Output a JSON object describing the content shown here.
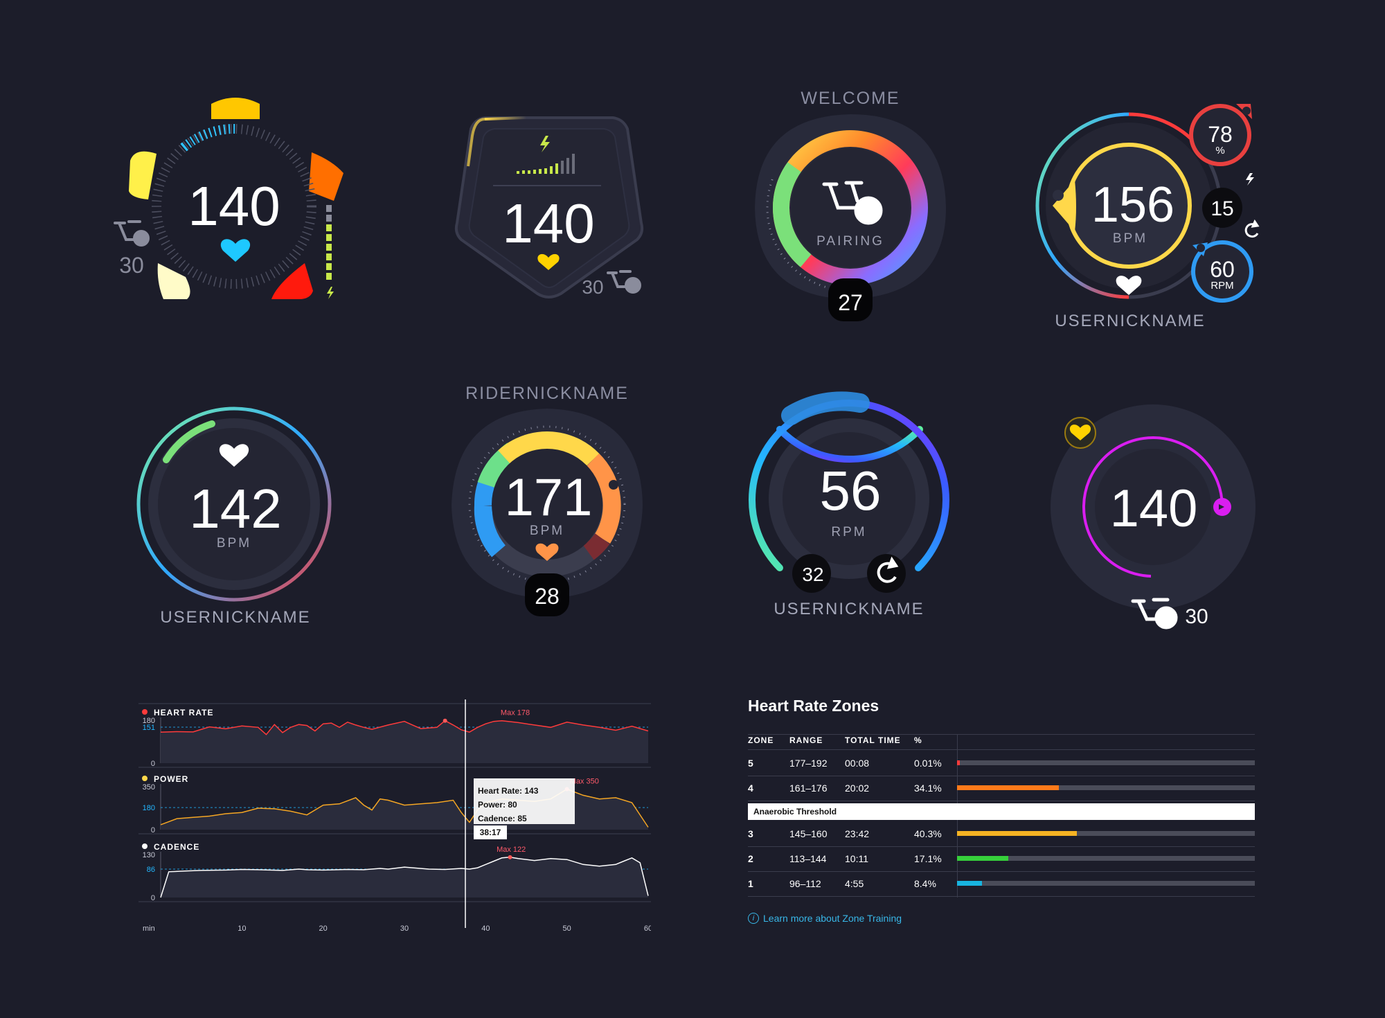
{
  "widgets": {
    "w1": {
      "value": "140",
      "bike_count": "30"
    },
    "w2": {
      "value": "140",
      "bike_count": "30"
    },
    "w3": {
      "title": "WELCOME",
      "status": "PAIRING",
      "badge": "27"
    },
    "w4": {
      "value": "156",
      "unit": "BPM",
      "nickname": "USERNICKNAME",
      "percent_value": "78",
      "percent_unit": "%",
      "power_value": "15",
      "cadence_value": "60",
      "cadence_unit": "RPM"
    },
    "w5": {
      "value": "142",
      "unit": "BPM",
      "nickname": "USERNICKNAME"
    },
    "w6": {
      "title": "RIDERNICKNAME",
      "value": "171",
      "unit": "BPM",
      "badge": "28"
    },
    "w7": {
      "value": "56",
      "unit": "RPM",
      "sub_value": "32",
      "nickname": "USERNICKNAME"
    },
    "w8": {
      "value": "140",
      "bike_count": "30"
    }
  },
  "chart_data": {
    "type": "line",
    "x_axis": {
      "label": "min",
      "ticks": [
        "10",
        "20",
        "30",
        "40",
        "50",
        "60"
      ],
      "range": [
        0,
        60
      ]
    },
    "cursor": {
      "x": 37.5,
      "time_label": "38:17"
    },
    "tooltip": {
      "heart_rate": "Heart Rate: 143",
      "power": "Power: 80",
      "cadence": "Cadence: 85"
    },
    "panels": [
      {
        "name": "HEART RATE",
        "color": "#ff3b3b",
        "ylim": [
          0,
          180
        ],
        "ticks": [
          "180",
          "0"
        ],
        "avg": 151,
        "avg_label": "151",
        "max_label": "Max 178",
        "max_x": 41.5,
        "x": [
          0,
          2,
          4,
          6,
          8,
          10,
          12,
          13,
          14,
          15,
          16,
          17,
          18,
          19,
          20,
          21,
          22,
          23,
          24,
          25,
          26,
          28,
          30,
          31,
          32,
          34,
          35,
          36,
          37,
          38,
          39,
          40,
          41,
          42,
          44,
          46,
          48,
          50,
          52,
          54,
          56,
          58,
          60
        ],
        "y": [
          130,
          132,
          131,
          152,
          144,
          156,
          150,
          120,
          162,
          128,
          150,
          162,
          158,
          135,
          165,
          168,
          150,
          172,
          160,
          150,
          142,
          160,
          175,
          160,
          145,
          150,
          178,
          160,
          140,
          130,
          150,
          165,
          175,
          178,
          170,
          160,
          150,
          172,
          160,
          150,
          138,
          155,
          135
        ]
      },
      {
        "name": "POWER",
        "color": "#f5a623",
        "ylim": [
          0,
          350
        ],
        "ticks": [
          "350",
          "0"
        ],
        "avg": 180,
        "avg_label": "180",
        "max_label": "Max 350",
        "max_x": 50,
        "x": [
          0,
          2,
          4,
          6,
          8,
          10,
          12,
          14,
          16,
          18,
          20,
          22,
          24,
          25,
          26,
          27,
          28,
          30,
          32,
          34,
          36,
          37,
          38,
          39,
          40,
          42,
          44,
          46,
          48,
          50,
          52,
          54,
          56,
          58,
          60
        ],
        "y": [
          40,
          90,
          100,
          110,
          130,
          140,
          175,
          170,
          150,
          120,
          200,
          210,
          260,
          200,
          160,
          250,
          240,
          200,
          210,
          220,
          240,
          140,
          60,
          160,
          220,
          250,
          240,
          230,
          250,
          330,
          280,
          250,
          260,
          220,
          20
        ]
      },
      {
        "name": "CADENCE",
        "color": "#ffffff",
        "ylim": [
          0,
          130
        ],
        "ticks": [
          "130",
          "0"
        ],
        "avg": 86,
        "avg_label": "86",
        "max_label": "Max 122",
        "max_x": 41,
        "x": [
          0,
          1,
          3,
          5,
          8,
          10,
          12,
          15,
          17,
          18,
          20,
          23,
          25,
          27,
          28,
          30,
          33,
          35,
          37,
          38,
          39,
          40,
          41,
          42,
          43,
          44,
          46,
          48,
          50,
          52,
          54,
          56,
          57,
          58,
          59,
          60
        ],
        "y": [
          0,
          78,
          80,
          82,
          83,
          85,
          84,
          82,
          86,
          84,
          83,
          85,
          84,
          88,
          86,
          92,
          86,
          85,
          88,
          86,
          90,
          100,
          110,
          120,
          122,
          118,
          112,
          118,
          115,
          100,
          95,
          100,
          110,
          120,
          105,
          5
        ]
      }
    ]
  },
  "zones": {
    "title": "Heart Rate Zones",
    "headers": {
      "zone": "ZONE",
      "range": "RANGE",
      "time": "TOTAL TIME",
      "pct": "%"
    },
    "threshold_label": "Anaerobic Threshold",
    "rows": [
      {
        "zone": "5",
        "range": "177–192",
        "time": "00:08",
        "pct": "0.01%",
        "fill": 0.01,
        "color": "#ff3b3b"
      },
      {
        "zone": "4",
        "range": "161–176",
        "time": "20:02",
        "pct": "34.1%",
        "fill": 0.341,
        "color": "#ff7a1a"
      },
      {
        "zone": "3",
        "range": "145–160",
        "time": "23:42",
        "pct": "40.3%",
        "fill": 0.403,
        "color": "#f5b323"
      },
      {
        "zone": "2",
        "range": "113–144",
        "time": "10:11",
        "pct": "17.1%",
        "fill": 0.171,
        "color": "#36d03b"
      },
      {
        "zone": "1",
        "range": "96–112",
        "time": "4:55",
        "pct": "8.4%",
        "fill": 0.084,
        "color": "#18b4e0"
      }
    ],
    "link": "Learn more about Zone Training"
  }
}
